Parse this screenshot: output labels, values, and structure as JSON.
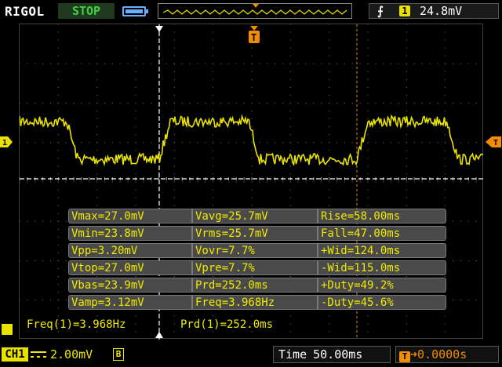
{
  "header": {
    "brand": "RIGOL",
    "run_state": "STOP",
    "trigger_edge_glyph": "⨍",
    "trigger_source": "1",
    "trigger_level": "24.8mV"
  },
  "measurements": [
    [
      "Vmax=27.0mV",
      "Vavg=25.7mV",
      "Rise=58.00ms"
    ],
    [
      "Vmin=23.8mV",
      "Vrms=25.7mV",
      "Fall=47.00ms"
    ],
    [
      "Vpp=3.20mV",
      "Vovr=7.7%",
      "+Wid=124.0ms"
    ],
    [
      "Vtop=27.0mV",
      "Vpre=7.7%",
      "-Wid=115.0ms"
    ],
    [
      "Vbas=23.9mV",
      "Prd=252.0ms",
      "+Duty=49.2%"
    ],
    [
      "Vamp=3.12mV",
      "Freq=3.968Hz",
      "-Duty=45.6%"
    ]
  ],
  "counter": {
    "freq": "Freq(1)=3.968Hz",
    "prd": "Prd(1)=252.0ms"
  },
  "footer": {
    "channel": "CH1",
    "volts_per_div": "2.00mV",
    "bandwidth_limit": "B",
    "time_label": "Time",
    "time_per_div": "50.00ms",
    "trigger_offset": "0.0000s"
  },
  "colors": {
    "channel1": "#e9e200",
    "trigger": "#f28c00",
    "run_state": "#3fd23f",
    "measurement_bg": "#4a4a4a"
  }
}
